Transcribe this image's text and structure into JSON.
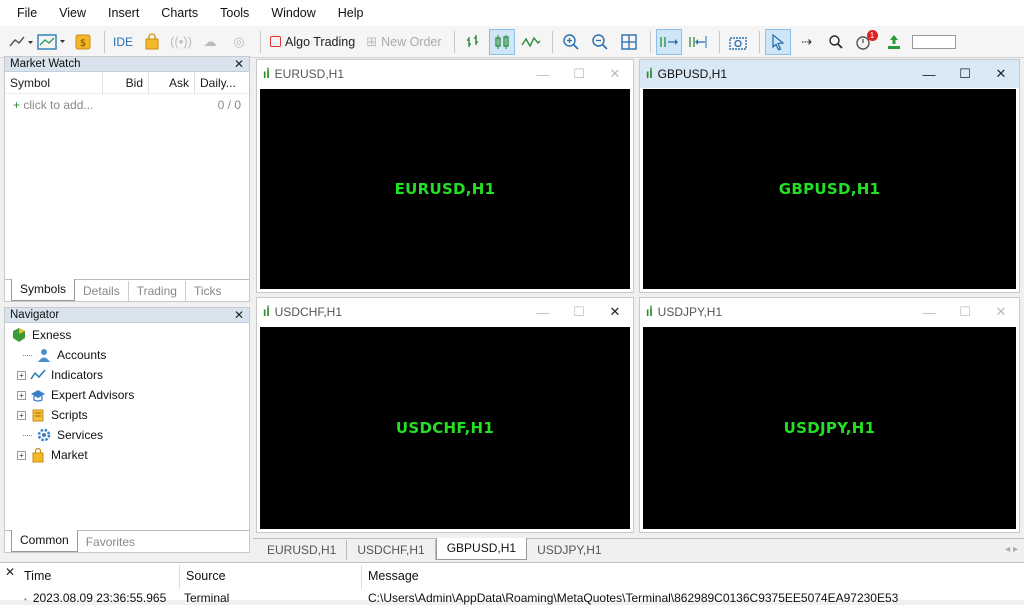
{
  "menu": [
    "File",
    "View",
    "Insert",
    "Charts",
    "Tools",
    "Window",
    "Help"
  ],
  "toolbar": {
    "ide_label": "IDE",
    "algo_trading_label": "Algo Trading",
    "new_order_label": "New Order",
    "alert_count": "1"
  },
  "market_watch": {
    "title": "Market Watch",
    "columns": [
      "Symbol",
      "Bid",
      "Ask",
      "Daily..."
    ],
    "add_row_label": "click to add...",
    "count": "0 / 0",
    "tabs": [
      "Symbols",
      "Details",
      "Trading",
      "Ticks"
    ]
  },
  "navigator": {
    "title": "Navigator",
    "root": "Exness",
    "items": [
      "Accounts",
      "Indicators",
      "Expert Advisors",
      "Scripts",
      "Services",
      "Market"
    ],
    "tabs": [
      "Common",
      "Favorites"
    ]
  },
  "charts": [
    {
      "title": "EURUSD,H1",
      "label": "EURUSD,H1"
    },
    {
      "title": "GBPUSD,H1",
      "label": "GBPUSD,H1"
    },
    {
      "title": "USDCHF,H1",
      "label": "USDCHF,H1"
    },
    {
      "title": "USDJPY,H1",
      "label": "USDJPY,H1"
    }
  ],
  "chart_tabs": [
    "EURUSD,H1",
    "USDCHF,H1",
    "GBPUSD,H1",
    "USDJPY,H1"
  ],
  "journal": {
    "columns": [
      "Time",
      "Source",
      "Message"
    ],
    "row": {
      "time": "2023.08.09 23:36:55.965",
      "source": "Terminal",
      "message": "C:\\Users\\Admin\\AppData\\Roaming\\MetaQuotes\\Terminal\\862989C0136C9375EE5074EA97230E53"
    }
  }
}
